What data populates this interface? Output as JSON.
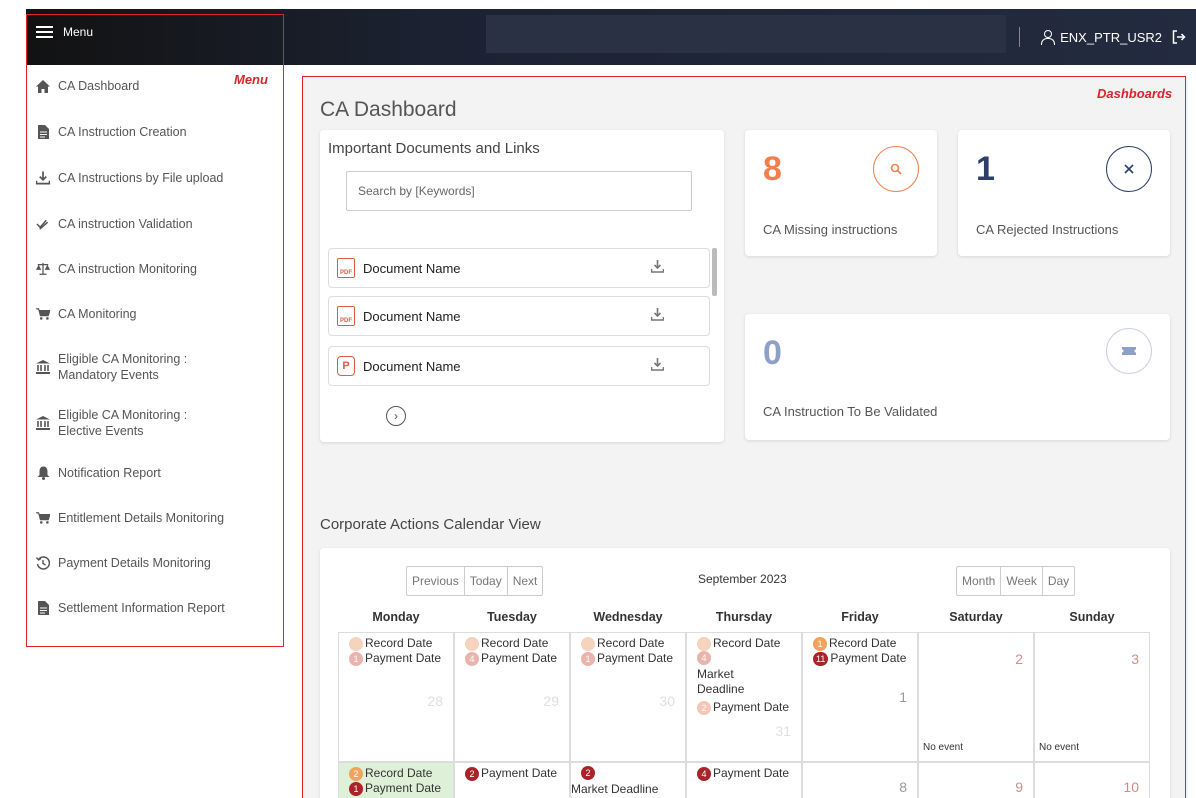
{
  "topbar": {
    "menu_label": "Menu",
    "username": "ENX_PTR_USR2"
  },
  "annotations": {
    "menu": "Menu",
    "dashboards": "Dashboards"
  },
  "sidebar": {
    "items": [
      {
        "label": "CA Dashboard",
        "icon": "home-icon"
      },
      {
        "label": "CA Instruction Creation",
        "icon": "file-icon"
      },
      {
        "label": "CA Instructions by File upload",
        "icon": "upload-icon"
      },
      {
        "label": "CA instruction Validation",
        "icon": "double-check-icon"
      },
      {
        "label": "CA instruction Monitoring",
        "icon": "balance-icon"
      },
      {
        "label": "CA Monitoring",
        "icon": "cart-icon"
      },
      {
        "label": "Eligible CA Monitoring :",
        "label2": "Mandatory Events",
        "icon": "bank-icon"
      },
      {
        "label": "Eligible CA Monitoring :",
        "label2": "Elective Events",
        "icon": "bank-icon"
      },
      {
        "label": "Notification Report",
        "icon": "bell-icon"
      },
      {
        "label": "Entitlement Details Monitoring",
        "icon": "cart-icon"
      },
      {
        "label": "Payment Details Monitoring",
        "icon": "history-icon"
      },
      {
        "label": "Settlement Information Report",
        "icon": "file-icon"
      }
    ]
  },
  "main": {
    "title": "CA Dashboard",
    "docs": {
      "title": "Important Documents and Links",
      "search_placeholder": "Search by [Keywords]",
      "documents": [
        {
          "name": "Document Name",
          "icon": "pdf-icon"
        },
        {
          "name": "Document Name",
          "icon": "pdf-icon"
        },
        {
          "name": "Document Name",
          "icon": "p-doc-icon"
        }
      ],
      "pdf_text": "PDF",
      "p_text": "P"
    },
    "stats": [
      {
        "value": "8",
        "label": "CA Missing instructions",
        "color": "#f0814e",
        "icon": "search-icon"
      },
      {
        "value": "1",
        "label": "CA Rejected Instructions",
        "color": "#2d3e6b",
        "icon": "close-icon"
      },
      {
        "value": "0",
        "label": "CA Instruction To Be Validated",
        "color": "#8fa0c8",
        "icon": "ticket-icon"
      }
    ],
    "calendar": {
      "title": "Corporate Actions Calendar View",
      "nav_buttons": [
        "Previous",
        "Today",
        "Next"
      ],
      "view_buttons": [
        "Month",
        "Week",
        "Day"
      ],
      "month": "September 2023",
      "days": [
        "Monday",
        "Tuesday",
        "Wednesday",
        "Thursday",
        "Friday",
        "Saturday",
        "Sunday"
      ],
      "no_event": "No event",
      "week1": [
        {
          "day": "28",
          "events": [
            {
              "count": "",
              "label": "Record Date"
            },
            {
              "count": "1",
              "label": "Payment Date"
            }
          ]
        },
        {
          "day": "29",
          "events": [
            {
              "count": "",
              "label": "Record Date"
            },
            {
              "count": "4",
              "label": "Payment Date"
            }
          ]
        },
        {
          "day": "30",
          "events": [
            {
              "count": "",
              "label": "Record Date"
            },
            {
              "count": "1",
              "label": "Payment Date"
            }
          ]
        },
        {
          "day": "31",
          "events": [
            {
              "count": "",
              "label": "Record Date"
            },
            {
              "count": "4",
              "label": "Market Deadline"
            },
            {
              "count": "2",
              "label": "Payment Date"
            }
          ]
        },
        {
          "day": "1",
          "events": [
            {
              "count": "1",
              "label": "Record Date"
            },
            {
              "count": "11",
              "label": "Payment Date"
            }
          ]
        },
        {
          "day": "2",
          "events": []
        },
        {
          "day": "3",
          "events": []
        }
      ],
      "week2": [
        {
          "day": "",
          "events": [
            {
              "count": "2",
              "label": "Record Date"
            },
            {
              "count": "1",
              "label": "Payment Date"
            }
          ]
        },
        {
          "day": "",
          "events": [
            {
              "count": "2",
              "label": "Payment Date"
            }
          ]
        },
        {
          "day": "",
          "events": [
            {
              "count": "2",
              "label": "Market Deadline"
            }
          ]
        },
        {
          "day": "",
          "events": [
            {
              "count": "4",
              "label": "Payment Date"
            }
          ]
        },
        {
          "day": "8",
          "events": []
        },
        {
          "day": "9",
          "events": []
        },
        {
          "day": "10",
          "events": []
        }
      ]
    }
  }
}
